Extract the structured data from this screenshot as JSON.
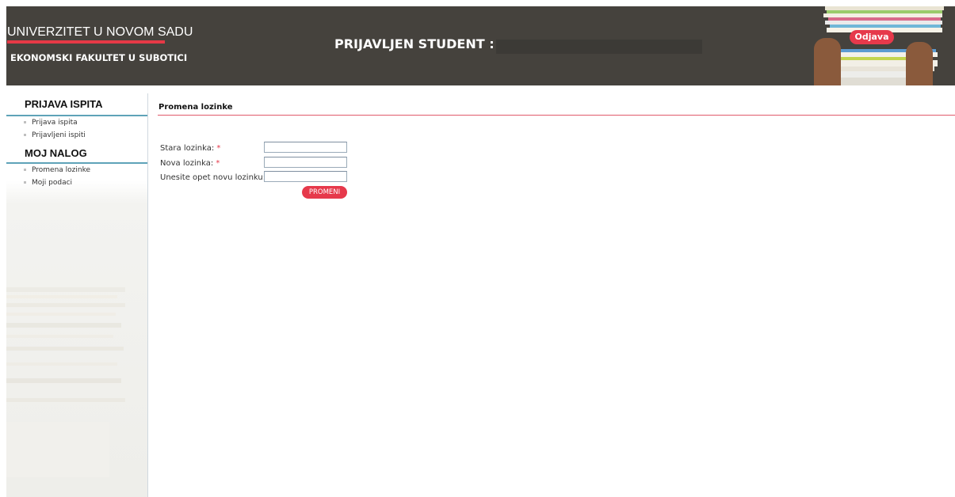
{
  "header": {
    "university": "UNIVERZITET U NOVOM SADU",
    "faculty": "EKONOMSKI FAKULTET U SUBOTICI",
    "student_label": "PRIJAVLJEN STUDENT :",
    "logout_label": "Odjava"
  },
  "sidebar": {
    "sections": [
      {
        "title": "PRIJAVA ISPITA",
        "items": [
          "Prijava ispita",
          "Prijavljeni ispiti"
        ]
      },
      {
        "title": "MOJ NALOG",
        "items": [
          "Promena lozinke",
          "Moji podaci"
        ]
      }
    ]
  },
  "content": {
    "title": "Promena lozinke",
    "fields": [
      {
        "label": "Stara lozinka:",
        "required_mark": "*",
        "value": ""
      },
      {
        "label": "Nova lozinka:",
        "required_mark": "*",
        "value": ""
      },
      {
        "label": "Unesite opet novu lozinku:",
        "required_mark": "*",
        "value": ""
      }
    ],
    "submit_label": "PROMENI"
  },
  "colors": {
    "header_bg": "#45423d",
    "accent_red": "#e6394b",
    "sidebar_line": "#5ea3b8"
  },
  "icons": [
    "bullet-icon",
    "books-stack-image"
  ]
}
